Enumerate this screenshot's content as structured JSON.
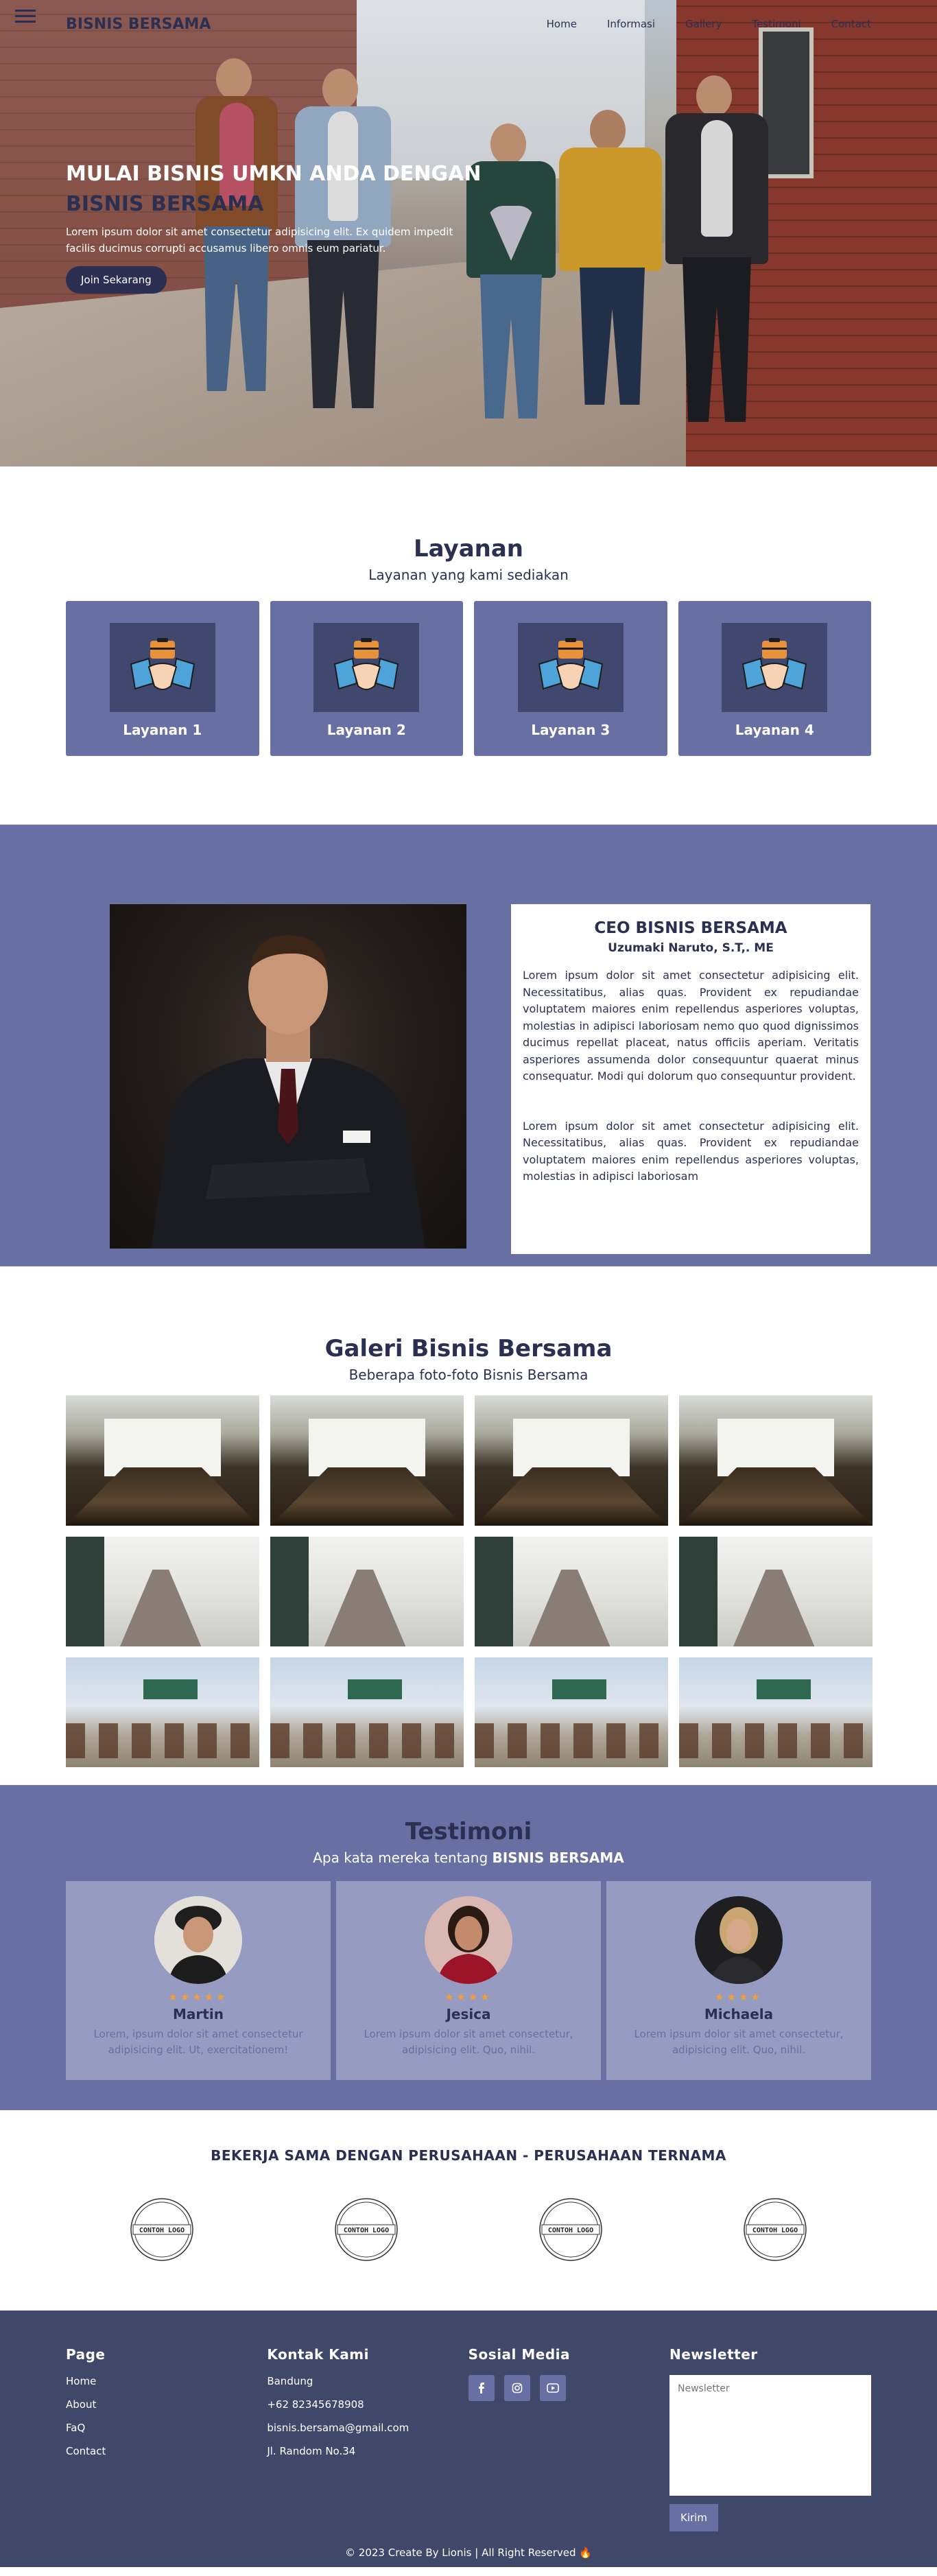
{
  "nav": {
    "brand": "BISNIS BERSAMA",
    "links": [
      "Home",
      "Informasi",
      "Gallery",
      "Testimoni",
      "Contact"
    ]
  },
  "hero": {
    "title_line1": "MULAI BISNIS UMKN ANDA DENGAN",
    "title_line2": "BISNIS BERSAMA",
    "description": "Lorem ipsum dolor sit amet consectetur adipisicing elit. Ex quidem impedit facilis ducimus corrupti accusamus libero omnis eum pariatur.",
    "button": "Join Sekarang"
  },
  "layanan": {
    "title": "Layanan",
    "subtitle": "Layanan yang kami sediakan",
    "items": [
      "Layanan 1",
      "Layanan 2",
      "Layanan 3",
      "Layanan 4"
    ]
  },
  "ceo": {
    "title": "CEO BISNIS BERSAMA",
    "name": "Uzumaki Naruto, S.T,. ME",
    "paragraph1": "Lorem ipsum dolor sit amet consectetur adipisicing elit. Necessitatibus, alias quas. Provident ex repudiandae voluptatem maiores enim repellendus asperiores voluptas, molestias in adipisci laboriosam nemo quo quod dignissimos ducimus repellat placeat, natus officiis aperiam. Veritatis asperiores assumenda dolor consequuntur quaerat minus consequatur. Modi qui dolorum quo consequuntur provident.",
    "paragraph2": "Lorem ipsum dolor sit amet consectetur adipisicing elit. Necessitatibus, alias quas. Provident ex repudiandae voluptatem maiores enim repellendus asperiores voluptas, molestias in adipisci laboriosam"
  },
  "galeri": {
    "title": "Galeri Bisnis Bersama",
    "subtitle": "Beberapa foto-foto Bisnis Bersama"
  },
  "testimoni": {
    "title": "Testimoni",
    "subtitle_prefix": "Apa kata mereka tentang",
    "subtitle_brand": "BISNIS BERSAMA",
    "items": [
      {
        "name": "Martin",
        "stars": "★★★★★",
        "text": "Lorem, ipsum dolor sit amet consectetur adipisicing elit. Ut, exercitationem!"
      },
      {
        "name": "Jesica",
        "stars": "★★★★",
        "text": "Lorem ipsum dolor sit amet consectetur, adipisicing elit. Quo, nihil."
      },
      {
        "name": "Michaela",
        "stars": "★★★★",
        "text": "Lorem ipsum dolor sit amet consectetur, adipisicing elit. Quo, nihil."
      }
    ]
  },
  "partner": {
    "title": "BEKERJA SAMA DENGAN PERUSAHAAN - PERUSAHAAN TERNAMA",
    "logo_text": "CONTOH LOGO"
  },
  "footer": {
    "page": {
      "title": "Page",
      "items": [
        "Home",
        "About",
        "FaQ",
        "Contact"
      ]
    },
    "kontak": {
      "title": "Kontak Kami",
      "items": [
        "Bandung",
        "+62 82345678908",
        "bisnis.bersama@gmail.com",
        "Jl. Random No.34"
      ]
    },
    "sosial": {
      "title": "Sosial Media",
      "icons": [
        "facebook-icon",
        "instagram-icon",
        "youtube-icon"
      ]
    },
    "newsletter": {
      "title": "Newsletter",
      "placeholder": "Newsletter",
      "button": "Kirim"
    },
    "copyright": "© 2023 Create By Lionis | All Right Reserved 🔥"
  },
  "colors": {
    "primary_dark": "#2b3052",
    "primary": "#676fa3",
    "footer_bg": "#404869",
    "star": "#f39c3b"
  }
}
